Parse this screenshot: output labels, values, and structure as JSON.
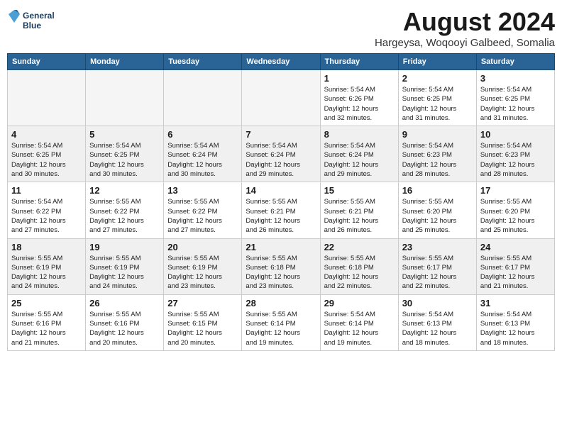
{
  "header": {
    "logo_line1": "General",
    "logo_line2": "Blue",
    "month_title": "August 2024",
    "subtitle": "Hargeysa, Woqooyi Galbeed, Somalia"
  },
  "weekdays": [
    "Sunday",
    "Monday",
    "Tuesday",
    "Wednesday",
    "Thursday",
    "Friday",
    "Saturday"
  ],
  "weeks": [
    [
      {
        "day": "",
        "info": "",
        "empty": true
      },
      {
        "day": "",
        "info": "",
        "empty": true
      },
      {
        "day": "",
        "info": "",
        "empty": true
      },
      {
        "day": "",
        "info": "",
        "empty": true
      },
      {
        "day": "1",
        "info": "Sunrise: 5:54 AM\nSunset: 6:26 PM\nDaylight: 12 hours\nand 32 minutes."
      },
      {
        "day": "2",
        "info": "Sunrise: 5:54 AM\nSunset: 6:25 PM\nDaylight: 12 hours\nand 31 minutes."
      },
      {
        "day": "3",
        "info": "Sunrise: 5:54 AM\nSunset: 6:25 PM\nDaylight: 12 hours\nand 31 minutes."
      }
    ],
    [
      {
        "day": "4",
        "info": "Sunrise: 5:54 AM\nSunset: 6:25 PM\nDaylight: 12 hours\nand 30 minutes.",
        "shaded": true
      },
      {
        "day": "5",
        "info": "Sunrise: 5:54 AM\nSunset: 6:25 PM\nDaylight: 12 hours\nand 30 minutes.",
        "shaded": true
      },
      {
        "day": "6",
        "info": "Sunrise: 5:54 AM\nSunset: 6:24 PM\nDaylight: 12 hours\nand 30 minutes.",
        "shaded": true
      },
      {
        "day": "7",
        "info": "Sunrise: 5:54 AM\nSunset: 6:24 PM\nDaylight: 12 hours\nand 29 minutes.",
        "shaded": true
      },
      {
        "day": "8",
        "info": "Sunrise: 5:54 AM\nSunset: 6:24 PM\nDaylight: 12 hours\nand 29 minutes.",
        "shaded": true
      },
      {
        "day": "9",
        "info": "Sunrise: 5:54 AM\nSunset: 6:23 PM\nDaylight: 12 hours\nand 28 minutes.",
        "shaded": true
      },
      {
        "day": "10",
        "info": "Sunrise: 5:54 AM\nSunset: 6:23 PM\nDaylight: 12 hours\nand 28 minutes.",
        "shaded": true
      }
    ],
    [
      {
        "day": "11",
        "info": "Sunrise: 5:54 AM\nSunset: 6:22 PM\nDaylight: 12 hours\nand 27 minutes."
      },
      {
        "day": "12",
        "info": "Sunrise: 5:55 AM\nSunset: 6:22 PM\nDaylight: 12 hours\nand 27 minutes."
      },
      {
        "day": "13",
        "info": "Sunrise: 5:55 AM\nSunset: 6:22 PM\nDaylight: 12 hours\nand 27 minutes."
      },
      {
        "day": "14",
        "info": "Sunrise: 5:55 AM\nSunset: 6:21 PM\nDaylight: 12 hours\nand 26 minutes."
      },
      {
        "day": "15",
        "info": "Sunrise: 5:55 AM\nSunset: 6:21 PM\nDaylight: 12 hours\nand 26 minutes."
      },
      {
        "day": "16",
        "info": "Sunrise: 5:55 AM\nSunset: 6:20 PM\nDaylight: 12 hours\nand 25 minutes."
      },
      {
        "day": "17",
        "info": "Sunrise: 5:55 AM\nSunset: 6:20 PM\nDaylight: 12 hours\nand 25 minutes."
      }
    ],
    [
      {
        "day": "18",
        "info": "Sunrise: 5:55 AM\nSunset: 6:19 PM\nDaylight: 12 hours\nand 24 minutes.",
        "shaded": true
      },
      {
        "day": "19",
        "info": "Sunrise: 5:55 AM\nSunset: 6:19 PM\nDaylight: 12 hours\nand 24 minutes.",
        "shaded": true
      },
      {
        "day": "20",
        "info": "Sunrise: 5:55 AM\nSunset: 6:19 PM\nDaylight: 12 hours\nand 23 minutes.",
        "shaded": true
      },
      {
        "day": "21",
        "info": "Sunrise: 5:55 AM\nSunset: 6:18 PM\nDaylight: 12 hours\nand 23 minutes.",
        "shaded": true
      },
      {
        "day": "22",
        "info": "Sunrise: 5:55 AM\nSunset: 6:18 PM\nDaylight: 12 hours\nand 22 minutes.",
        "shaded": true
      },
      {
        "day": "23",
        "info": "Sunrise: 5:55 AM\nSunset: 6:17 PM\nDaylight: 12 hours\nand 22 minutes.",
        "shaded": true
      },
      {
        "day": "24",
        "info": "Sunrise: 5:55 AM\nSunset: 6:17 PM\nDaylight: 12 hours\nand 21 minutes.",
        "shaded": true
      }
    ],
    [
      {
        "day": "25",
        "info": "Sunrise: 5:55 AM\nSunset: 6:16 PM\nDaylight: 12 hours\nand 21 minutes."
      },
      {
        "day": "26",
        "info": "Sunrise: 5:55 AM\nSunset: 6:16 PM\nDaylight: 12 hours\nand 20 minutes."
      },
      {
        "day": "27",
        "info": "Sunrise: 5:55 AM\nSunset: 6:15 PM\nDaylight: 12 hours\nand 20 minutes."
      },
      {
        "day": "28",
        "info": "Sunrise: 5:55 AM\nSunset: 6:14 PM\nDaylight: 12 hours\nand 19 minutes."
      },
      {
        "day": "29",
        "info": "Sunrise: 5:54 AM\nSunset: 6:14 PM\nDaylight: 12 hours\nand 19 minutes."
      },
      {
        "day": "30",
        "info": "Sunrise: 5:54 AM\nSunset: 6:13 PM\nDaylight: 12 hours\nand 18 minutes."
      },
      {
        "day": "31",
        "info": "Sunrise: 5:54 AM\nSunset: 6:13 PM\nDaylight: 12 hours\nand 18 minutes."
      }
    ]
  ]
}
